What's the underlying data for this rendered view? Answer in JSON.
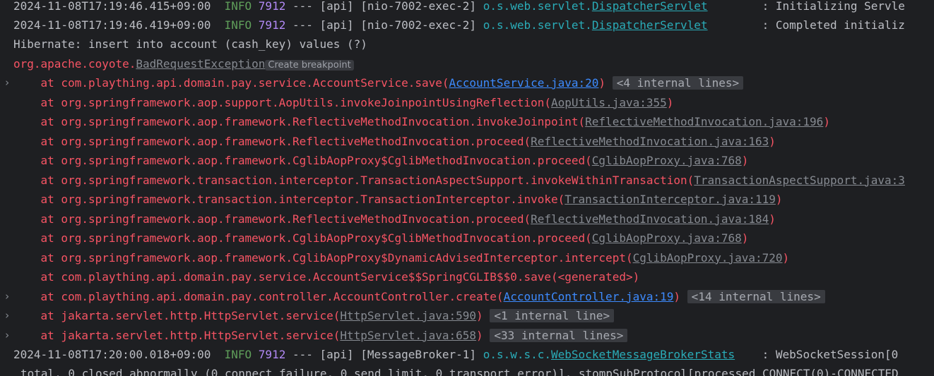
{
  "log": {
    "line1": {
      "timestamp": "2024-11-08T17:19:46.415+09:00",
      "level": "INFO",
      "pid": "7912",
      "thread": " --- [api] [nio-7002-exec-2] ",
      "logger_pkg": "o.s.web.servlet.",
      "logger_class": "DispatcherServlet",
      "message": "        : Initializing Servle"
    },
    "line2": {
      "timestamp": "2024-11-08T17:19:46.419+09:00",
      "level": "INFO",
      "pid": "7912",
      "thread": " --- [api] [nio-7002-exec-2] ",
      "logger_pkg": "o.s.web.servlet.",
      "logger_class": "DispatcherServlet",
      "message": "        : Completed initializ"
    },
    "hibernate": "Hibernate: insert into account (cash_key) values (?)",
    "exception": {
      "pkg": "org.apache.coyote.",
      "name": "BadRequestException",
      "breakpoint": "Create breakpoint"
    },
    "trace": [
      {
        "prefix": "    at com.plaything.api.domain.pay.service.AccountService.save(",
        "link": "AccountService.java:20",
        "suffix": ")",
        "folded": "<4 internal lines>",
        "link_style": "blue",
        "expandable": true
      },
      {
        "prefix": "    at org.springframework.aop.support.AopUtils.invokeJoinpointUsingReflection(",
        "link": "AopUtils.java:355",
        "suffix": ")",
        "folded": "",
        "link_style": "gray",
        "expandable": false
      },
      {
        "prefix": "    at org.springframework.aop.framework.ReflectiveMethodInvocation.invokeJoinpoint(",
        "link": "ReflectiveMethodInvocation.java:196",
        "suffix": ")",
        "folded": "",
        "link_style": "gray",
        "expandable": false
      },
      {
        "prefix": "    at org.springframework.aop.framework.ReflectiveMethodInvocation.proceed(",
        "link": "ReflectiveMethodInvocation.java:163",
        "suffix": ")",
        "folded": "",
        "link_style": "gray",
        "expandable": false
      },
      {
        "prefix": "    at org.springframework.aop.framework.CglibAopProxy$CglibMethodInvocation.proceed(",
        "link": "CglibAopProxy.java:768",
        "suffix": ")",
        "folded": "",
        "link_style": "gray",
        "expandable": false
      },
      {
        "prefix": "    at org.springframework.transaction.interceptor.TransactionAspectSupport.invokeWithinTransaction(",
        "link": "TransactionAspectSupport.java:3",
        "suffix": "",
        "folded": "",
        "link_style": "gray",
        "expandable": false
      },
      {
        "prefix": "    at org.springframework.transaction.interceptor.TransactionInterceptor.invoke(",
        "link": "TransactionInterceptor.java:119",
        "suffix": ")",
        "folded": "",
        "link_style": "gray",
        "expandable": false
      },
      {
        "prefix": "    at org.springframework.aop.framework.ReflectiveMethodInvocation.proceed(",
        "link": "ReflectiveMethodInvocation.java:184",
        "suffix": ")",
        "folded": "",
        "link_style": "gray",
        "expandable": false
      },
      {
        "prefix": "    at org.springframework.aop.framework.CglibAopProxy$CglibMethodInvocation.proceed(",
        "link": "CglibAopProxy.java:768",
        "suffix": ")",
        "folded": "",
        "link_style": "gray",
        "expandable": false
      },
      {
        "prefix": "    at org.springframework.aop.framework.CglibAopProxy$DynamicAdvisedInterceptor.intercept(",
        "link": "CglibAopProxy.java:720",
        "suffix": ")",
        "folded": "",
        "link_style": "gray",
        "expandable": false
      },
      {
        "prefix": "    at com.plaything.api.domain.pay.service.AccountService$$SpringCGLIB$$0.save(<generated>)",
        "link": "",
        "suffix": "",
        "folded": "",
        "link_style": "gray",
        "expandable": false
      },
      {
        "prefix": "    at com.plaything.api.domain.pay.controller.AccountController.create(",
        "link": "AccountController.java:19",
        "suffix": ")",
        "folded": "<14 internal lines>",
        "link_style": "blue",
        "expandable": true
      },
      {
        "prefix": "    at jakarta.servlet.http.HttpServlet.service(",
        "link": "HttpServlet.java:590",
        "suffix": ")",
        "folded": "<1 internal line>",
        "link_style": "gray",
        "expandable": true
      },
      {
        "prefix": "    at jakarta.servlet.http.HttpServlet.service(",
        "link": "HttpServlet.java:658",
        "suffix": ")",
        "folded": "<33 internal lines>",
        "link_style": "gray",
        "expandable": true
      }
    ],
    "line3": {
      "timestamp": "2024-11-08T17:20:00.018+09:00",
      "level": "INFO",
      "pid": "7912",
      "thread": " --- [api] [MessageBroker-1] ",
      "logger_pkg": "o.s.w.s.c.",
      "logger_class": "WebSocketMessageBrokerStats",
      "message": "    : WebSocketSession[0"
    },
    "line4": "total, 0 closed abnormally (0 connect failure, 0 send limit, 0 transport error)], stompSubProtocol[processed CONNECT(0)-CONNECTED",
    "gutter_icon": "chevron-right-icon"
  },
  "colors": {
    "background": "#1e1f22",
    "error": "#f75464",
    "info": "#5f9e5a",
    "link": "#3d8bff",
    "logger": "#2aacb8"
  }
}
